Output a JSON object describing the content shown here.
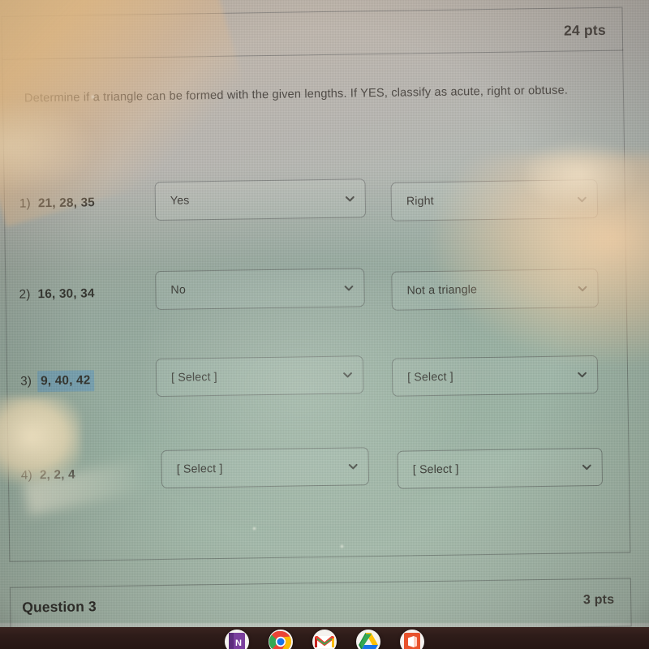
{
  "header": {
    "points": "24 pts"
  },
  "prompt": {
    "text": "Determine if a triangle can be formed with the given lengths.  If YES, classify as acute, right or obtuse."
  },
  "rows": [
    {
      "number": "1)",
      "lengths": "21, 28, 35",
      "highlighted": false,
      "select_formable": "Yes",
      "select_classify": "Right"
    },
    {
      "number": "2)",
      "lengths": "16, 30, 34",
      "highlighted": false,
      "select_formable": "No",
      "select_classify": "Not a triangle"
    },
    {
      "number": "3)",
      "lengths": "9, 40, 42",
      "highlighted": true,
      "select_formable": "[ Select ]",
      "select_classify": "[ Select ]"
    },
    {
      "number": "4)",
      "lengths": "2, 2, 4",
      "highlighted": false,
      "select_formable": "[ Select ]",
      "select_classify": "[ Select ]"
    }
  ],
  "next_question": {
    "label": "Question 3",
    "points": "3 pts"
  },
  "taskbar": {
    "icons": [
      {
        "name": "onenote-icon",
        "letter": "N"
      },
      {
        "name": "chrome-icon",
        "letter": ""
      },
      {
        "name": "gmail-icon",
        "letter": "M"
      },
      {
        "name": "google-drive-icon",
        "letter": ""
      },
      {
        "name": "office-icon",
        "letter": ""
      }
    ]
  },
  "colors": {
    "selection_highlight": "#8fb4cd",
    "screen_tint": "#b8c6bd",
    "taskbar": "#2e1c19",
    "text": "#3b3833"
  }
}
